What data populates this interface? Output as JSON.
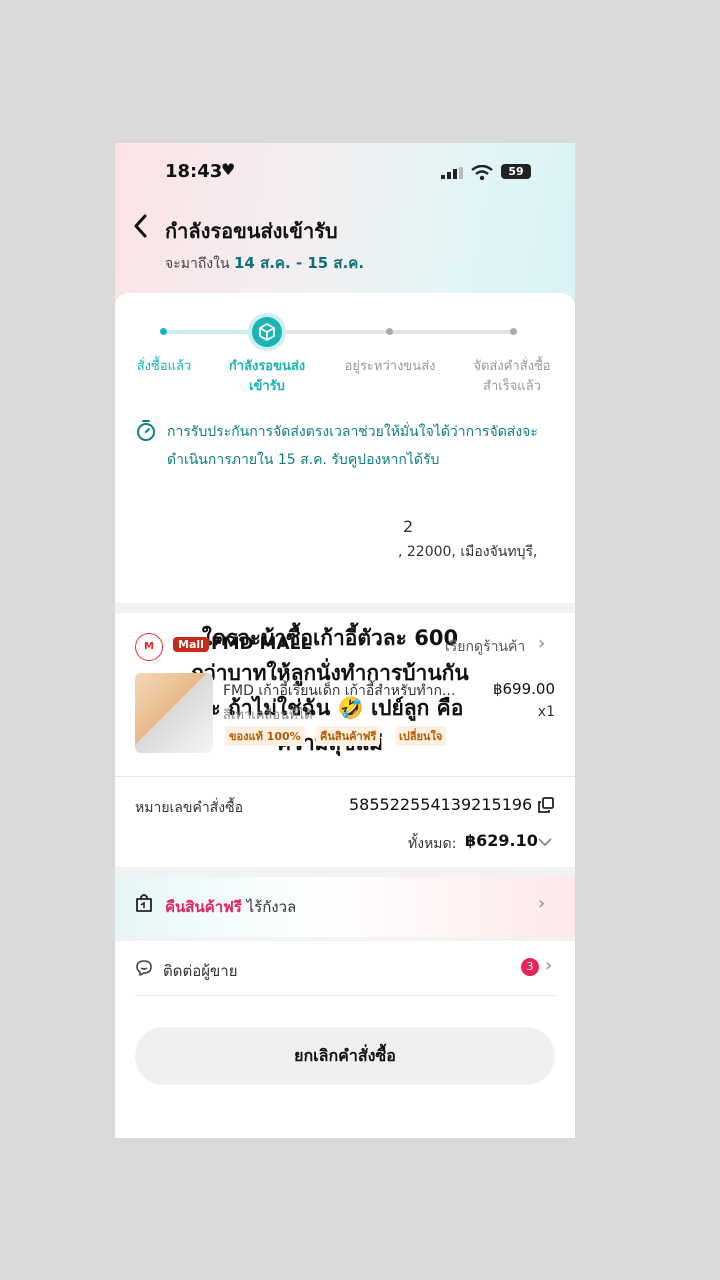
{
  "status_bar": {
    "time": "18:43",
    "battery": "59"
  },
  "header": {
    "title": "กำลังรอขนส่งเข้ารับ",
    "eta_prefix": "จะมาถึงใน",
    "eta_range": "14 ส.ค. - 15 ส.ค."
  },
  "progress": {
    "steps": [
      {
        "label": "สั่งซื้อแล้ว",
        "state": "done"
      },
      {
        "label": "กำลังรอขนส่ง เข้ารับ",
        "state": "current"
      },
      {
        "label": "อยู่ระหว่างขนส่ง",
        "state": "pending"
      },
      {
        "label": "จัดส่งคำสั่งซื้อ สำเร็จแล้ว",
        "state": "pending"
      }
    ]
  },
  "notice": {
    "text": "การรับประกันการจัดส่งตรงเวลาช่วยให้มั่นใจได้ว่าการจัดส่งจะดำเนินการภายใน 15 ส.ค. รับคูปองหากได้รับ"
  },
  "address": {
    "line1_fragment": "2",
    "line2_fragment": ", 22000, เมืองจันทบุรี,"
  },
  "overlay_caption": {
    "lines": [
      "ใครจะบ้าซื้อเก้าอี้ตัวละ 600",
      "กว่าบาทให้ลูกนั่งทำการบ้านกัน",
      "ล่ะ ถ้าไม่ใช่ฉัน 🤣 เปย์ลูก คือ",
      "ความสุขแม่"
    ]
  },
  "shop": {
    "logo_text": "M",
    "badge": "Mall",
    "name": "FMD MALL",
    "view_shop": "เรียกดูร้านค้า"
  },
  "product": {
    "name": "FMD เก้าอี้เรียนเด็ก เก้าอี้สำหรับทำก...",
    "price": "฿699.00",
    "variant": "สีเทาเคลื่อนที่ได้",
    "qty": "x1",
    "tags": [
      "ของแท้ 100%",
      "คืนสินค้าฟรี",
      "เปลี่ยนใจ"
    ]
  },
  "order": {
    "number_label": "หมายเลขคำสั่งซื้อ",
    "number": "585522554139215196",
    "total_label": "ทั้งหมด:",
    "total": "฿629.10"
  },
  "return_banner": {
    "highlight": "คืนสินค้าฟรี",
    "text": "ไร้กังวล"
  },
  "contact": {
    "label": "ติดต่อผู้ขาย",
    "unread": "3"
  },
  "actions": {
    "cancel": "ยกเลิกคำสั่งซื้อ"
  },
  "colors": {
    "accent": "#1ab4b6",
    "teal_text": "#0e7f82",
    "pink": "#e8245a",
    "mall_red": "#c52a1d"
  }
}
